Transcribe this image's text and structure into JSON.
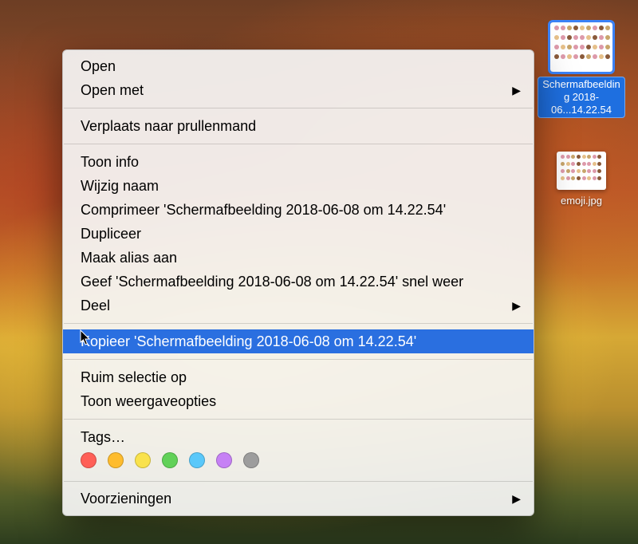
{
  "desktop": {
    "files": [
      {
        "label": "Schermafbeelding 2018-06...14.22.54",
        "selected": true
      },
      {
        "label": "emoji.jpg",
        "selected": false
      }
    ]
  },
  "menu": {
    "open": "Open",
    "open_with": "Open met",
    "trash": "Verplaats naar prullenmand",
    "info": "Toon info",
    "rename": "Wijzig naam",
    "compress": "Comprimeer 'Schermafbeelding 2018-06-08 om 14.22.54'",
    "duplicate": "Dupliceer",
    "alias": "Maak alias aan",
    "quicklook": "Geef 'Schermafbeelding 2018-06-08 om 14.22.54' snel weer",
    "share": "Deel",
    "copy": "Kopieer 'Schermafbeelding 2018-06-08 om 14.22.54'",
    "cleanup": "Ruim selectie op",
    "viewopts": "Toon weergaveopties",
    "tags": "Tags…",
    "services": "Voorzieningen"
  },
  "tags": {
    "colors": [
      "#ff5f57",
      "#febc2e",
      "#f9e24c",
      "#61d158",
      "#5ac8fa",
      "#c681f5",
      "#9d9d9d"
    ]
  }
}
